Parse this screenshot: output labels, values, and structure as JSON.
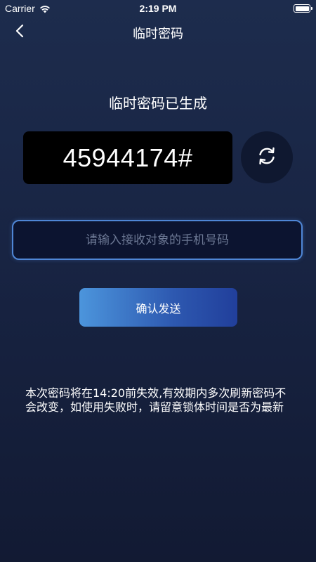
{
  "status_bar": {
    "carrier": "Carrier",
    "time": "2:19 PM",
    "battery_level": 1.0,
    "icons": [
      "wifi-icon",
      "battery-icon"
    ]
  },
  "nav": {
    "title": "临时密码",
    "back_icon": "chevron-left-icon"
  },
  "main": {
    "heading": "临时密码已生成",
    "password": "45944174#",
    "refresh_icon": "refresh-icon",
    "phone_input": {
      "placeholder": "请输入接收对象的手机号码",
      "value": ""
    },
    "confirm_label": "确认发送",
    "notice": "本次密码将在14:20前失效,有效期内多次刷新密码不会改变，如使用失败时，请留意锁体时间是否为最新"
  },
  "colors": {
    "background_top": "#1d2c4d",
    "background_bottom": "#121a33",
    "input_border": "#4f86d6",
    "button_gradient_start": "#4c95dc",
    "button_gradient_end": "#213f9b",
    "code_box": "#000000"
  }
}
